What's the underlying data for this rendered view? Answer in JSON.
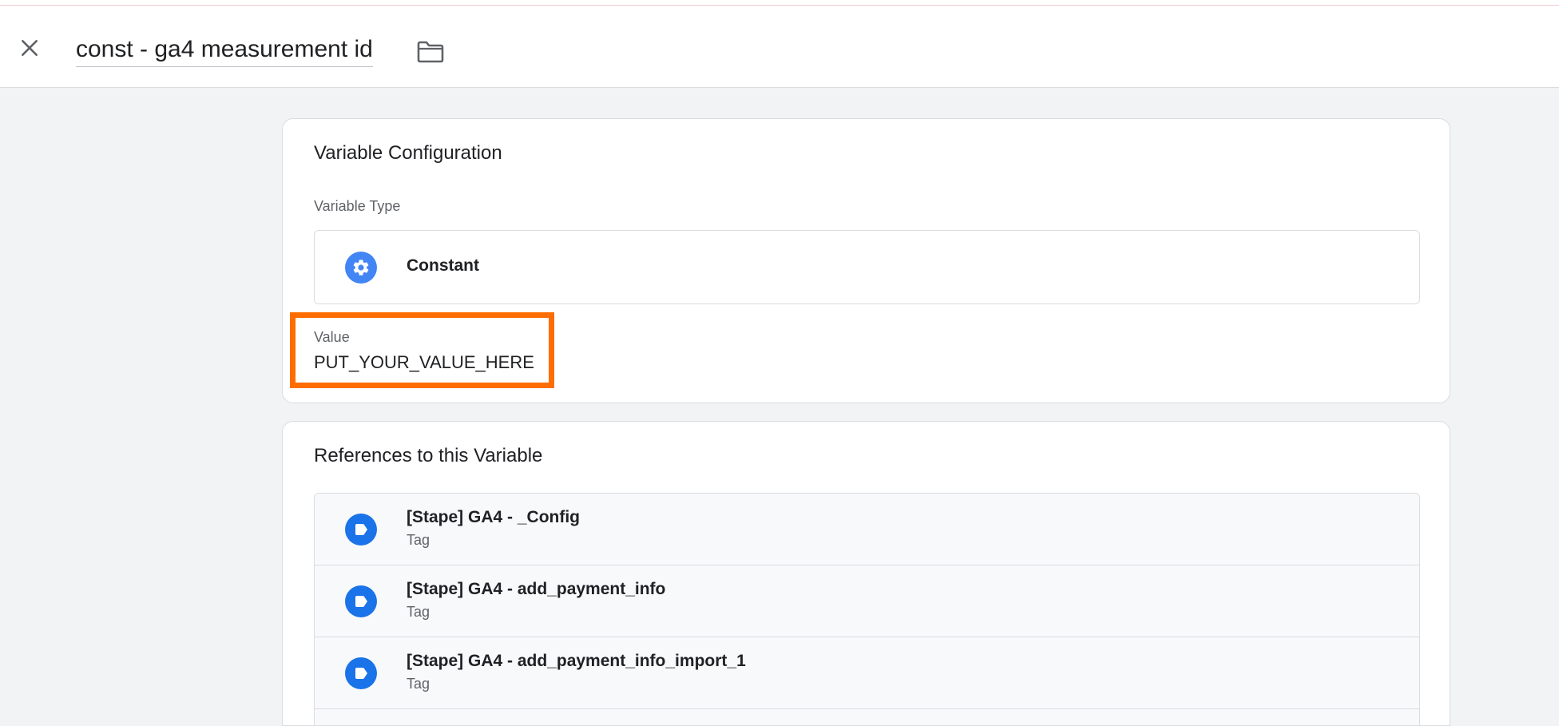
{
  "header": {
    "title": "const - ga4 measurement id",
    "close_icon": "close-icon",
    "folder_icon": "folder-icon"
  },
  "config_card": {
    "title": "Variable Configuration",
    "variable_type_label": "Variable Type",
    "variable_type": {
      "name": "Constant",
      "icon": "gear-icon",
      "icon_color": "#4285f4"
    },
    "value_label": "Value",
    "value": "PUT_YOUR_VALUE_HERE",
    "highlight_color": "#ff6d00"
  },
  "references_card": {
    "title": "References to this Variable",
    "items": [
      {
        "name": "[Stape] GA4 - _Config",
        "type": "Tag",
        "icon": "tag-icon"
      },
      {
        "name": "[Stape] GA4 - add_payment_info",
        "type": "Tag",
        "icon": "tag-icon"
      },
      {
        "name": "[Stape] GA4 - add_payment_info_import_1",
        "type": "Tag",
        "icon": "tag-icon"
      }
    ]
  }
}
